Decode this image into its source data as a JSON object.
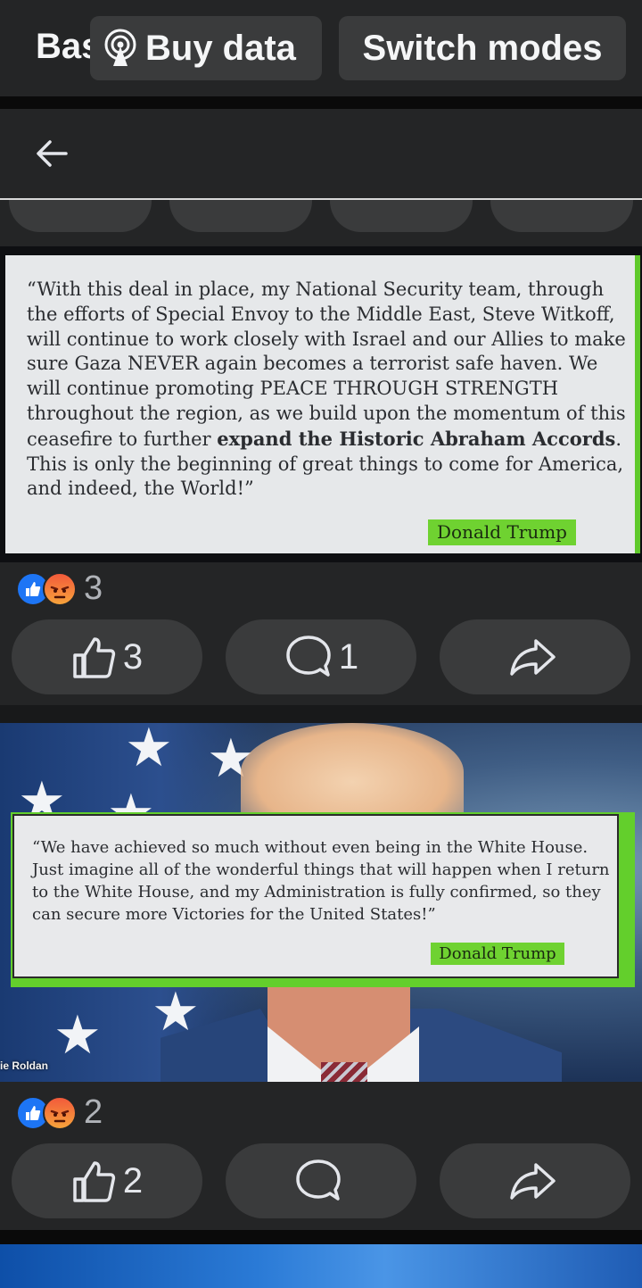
{
  "mode_bar": {
    "basic_label": "Bas",
    "buy_data_label": "Buy data",
    "switch_modes_label": "Switch modes"
  },
  "post1": {
    "quote": "“With this deal in place, my National Security team, through the efforts of Special Envoy to the Middle East, Steve Witkoff, will continue to work closely with Israel and our Allies to make sure Gaza NEVER again becomes a terrorist safe haven. We will continue promoting PEACE THROUGH STRENGTH throughout the region, as we build upon the momentum of this ceasefire to further ",
    "quote_bold": "expand the Historic Abraham Accords",
    "quote_end": ". This is only the beginning of great things to come for America, and indeed, the World!”",
    "signature": "Donald Trump",
    "reaction_count": "3",
    "like_count": "3",
    "comment_count": "1"
  },
  "post2": {
    "quote": "“We have achieved so much without even being in the White House. Just imagine all of the wonderful things that will happen when I return to the White House, and my Administration is fully confirmed, so they can secure more Victories for the United States!”",
    "signature": "Donald Trump",
    "credit": "ie Roldan",
    "reaction_count": "2",
    "like_count": "2"
  },
  "icons": [
    "back-arrow-icon",
    "broadcast-icon",
    "like-icon",
    "angry-icon",
    "thumbs-up-icon",
    "comment-icon",
    "share-icon"
  ],
  "colors": {
    "accent_green": "#6fd231",
    "like_blue": "#1d75f5",
    "button_bg": "#3a3b3c",
    "surface": "#242526"
  }
}
